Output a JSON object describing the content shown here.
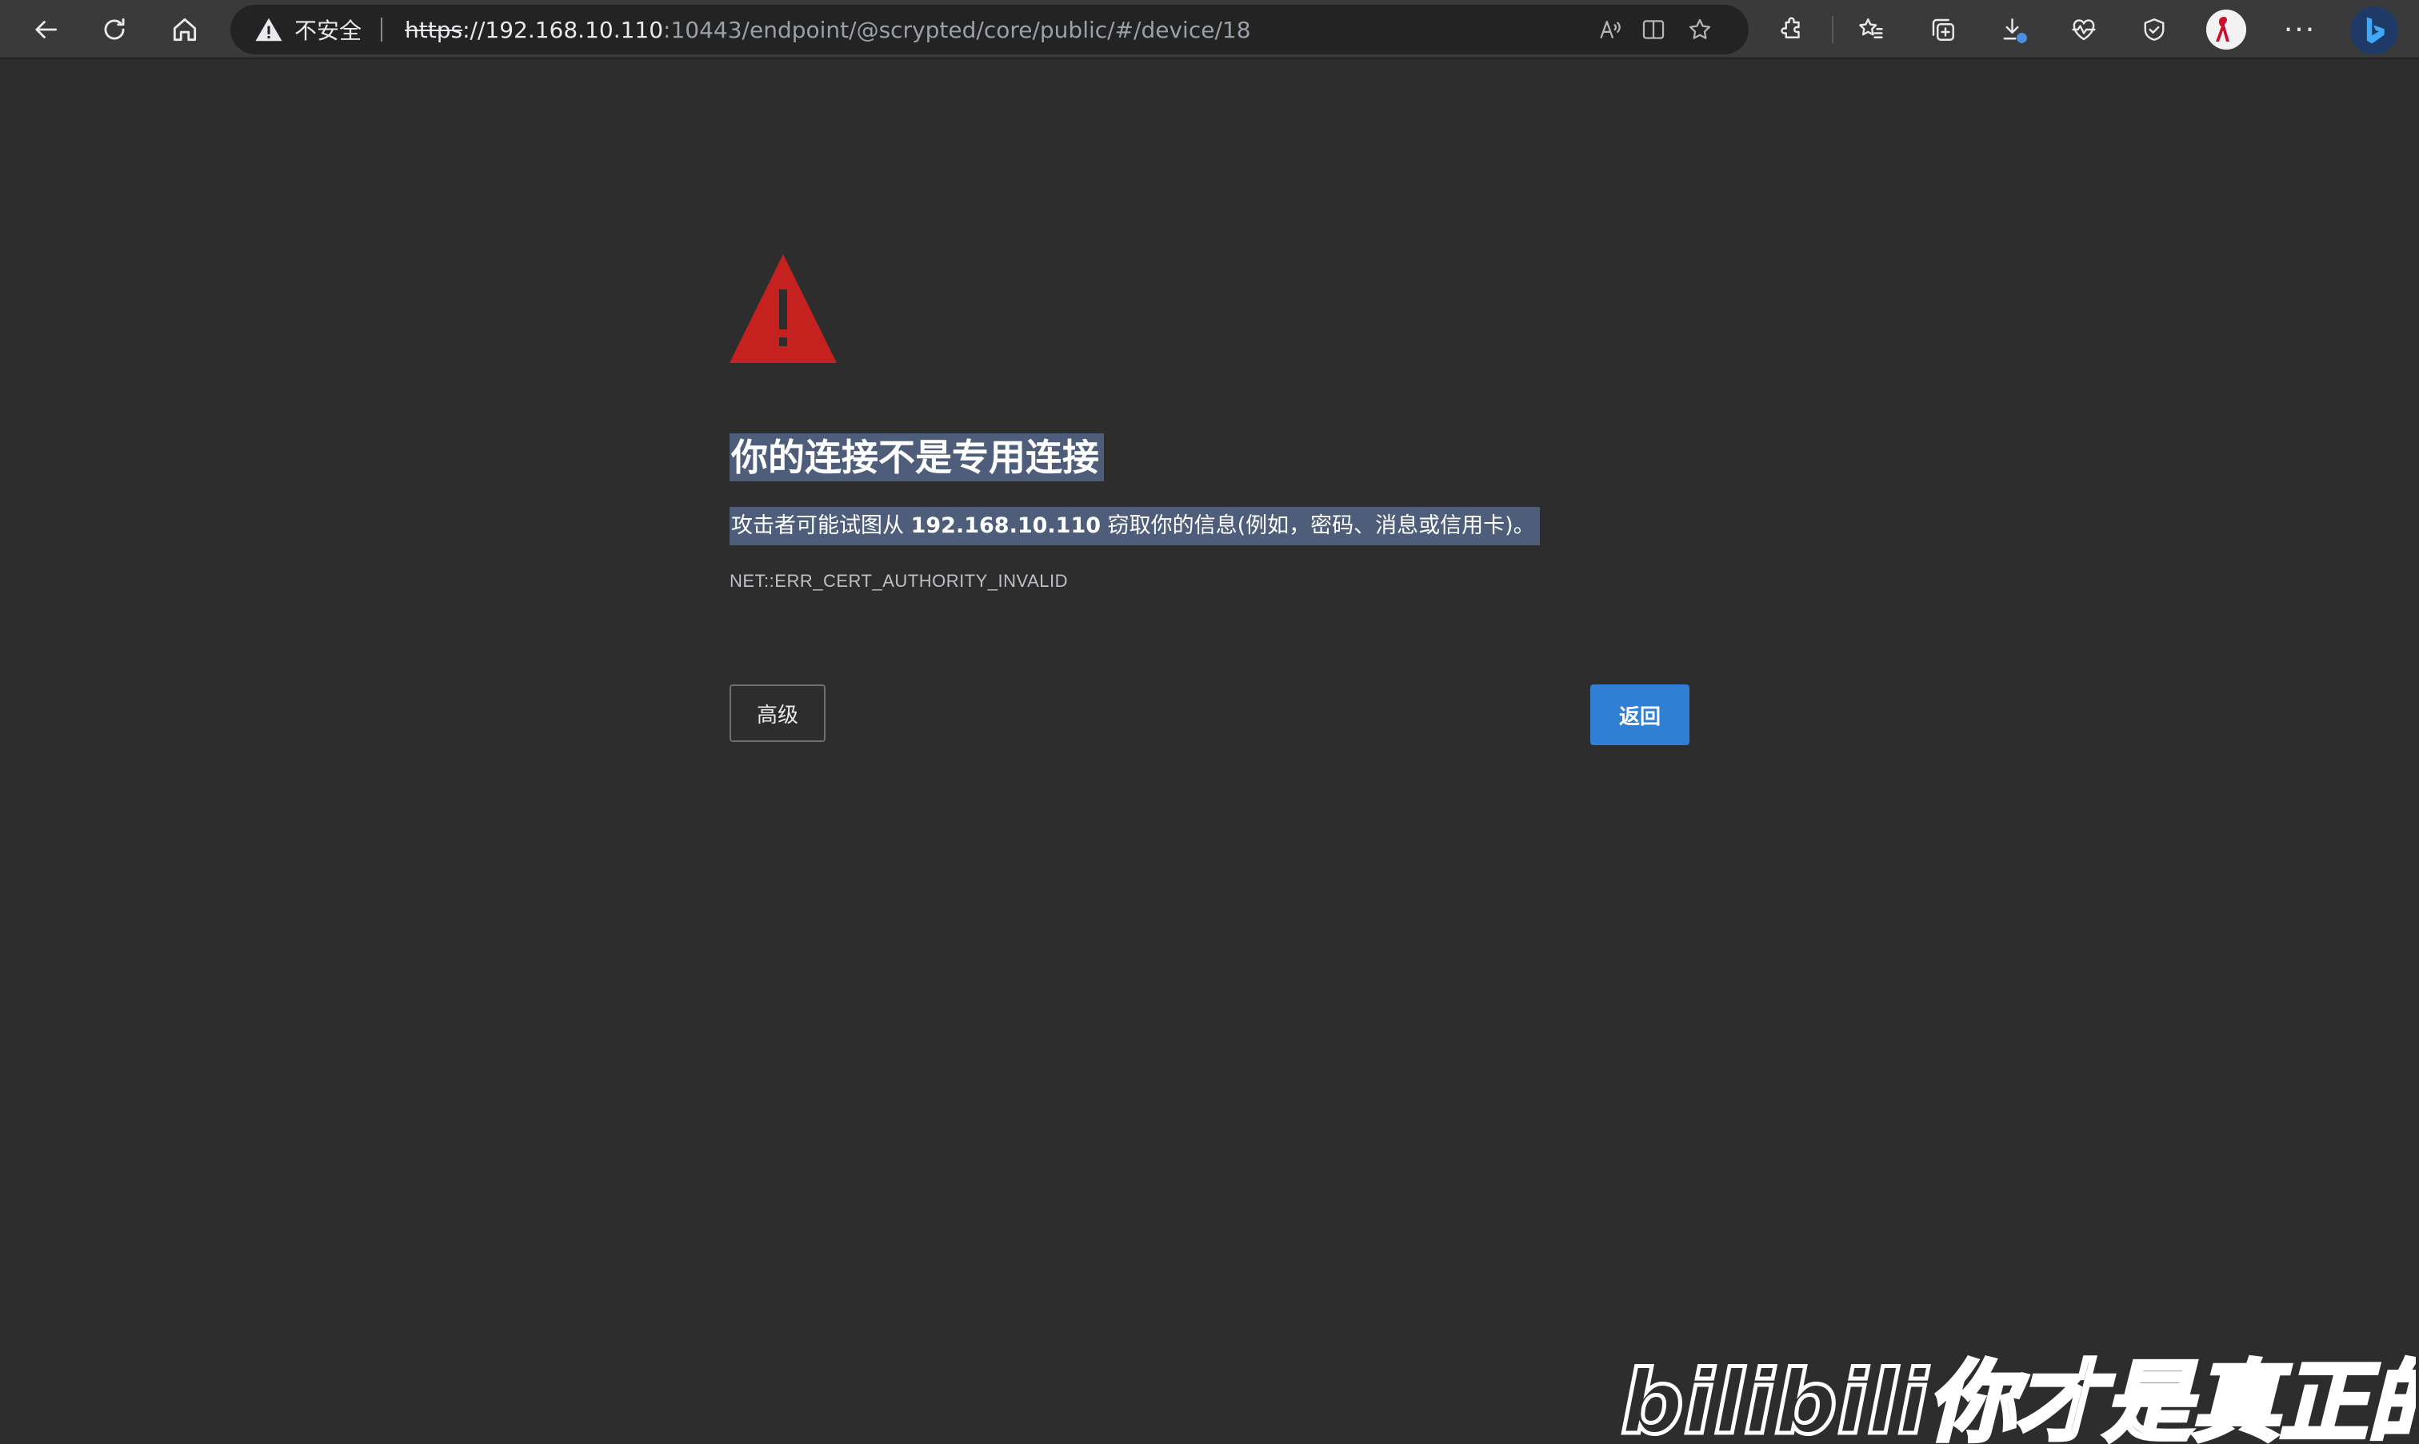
{
  "browser": {
    "address_bar": {
      "security_label": "不安全",
      "url_scheme": "https",
      "url_host": "://192.168.10.110",
      "url_rest": ":10443/endpoint/@scrypted/core/public/#/device/18"
    },
    "icons": {
      "back": "back-arrow-icon",
      "refresh": "refresh-icon",
      "home": "home-icon",
      "read_aloud": "read-aloud-icon",
      "split_screen": "split-screen-icon",
      "favorite": "star-icon",
      "extensions": "puzzle-icon",
      "favorites_list": "favorites-list-icon",
      "collections": "collections-icon",
      "downloads": "download-icon",
      "health": "heartbeat-icon",
      "copilot": "browser-essentials-icon",
      "profile": "profile-avatar-icon",
      "more": "more-icon",
      "bing": "bing-icon"
    },
    "more_label": "···"
  },
  "page": {
    "heading": "你的连接不是专用连接",
    "description_prefix": "攻击者可能试图从 ",
    "description_host": "192.168.10.110",
    "description_suffix": " 窃取你的信息(例如，密码、消息或信用卡)。",
    "error_code": "NET::ERR_CERT_AUTHORITY_INVALID",
    "advanced_button": "高级",
    "back_button": "返回"
  },
  "watermark": {
    "text": "bilibili你才是真正的快乐"
  },
  "colors": {
    "page_bg": "#2d2d2d",
    "toolbar_bg": "#3a3a3a",
    "warning_red": "#c5221f",
    "selection_bg": "#4e5d7a",
    "primary_button": "#2f7fd4"
  }
}
